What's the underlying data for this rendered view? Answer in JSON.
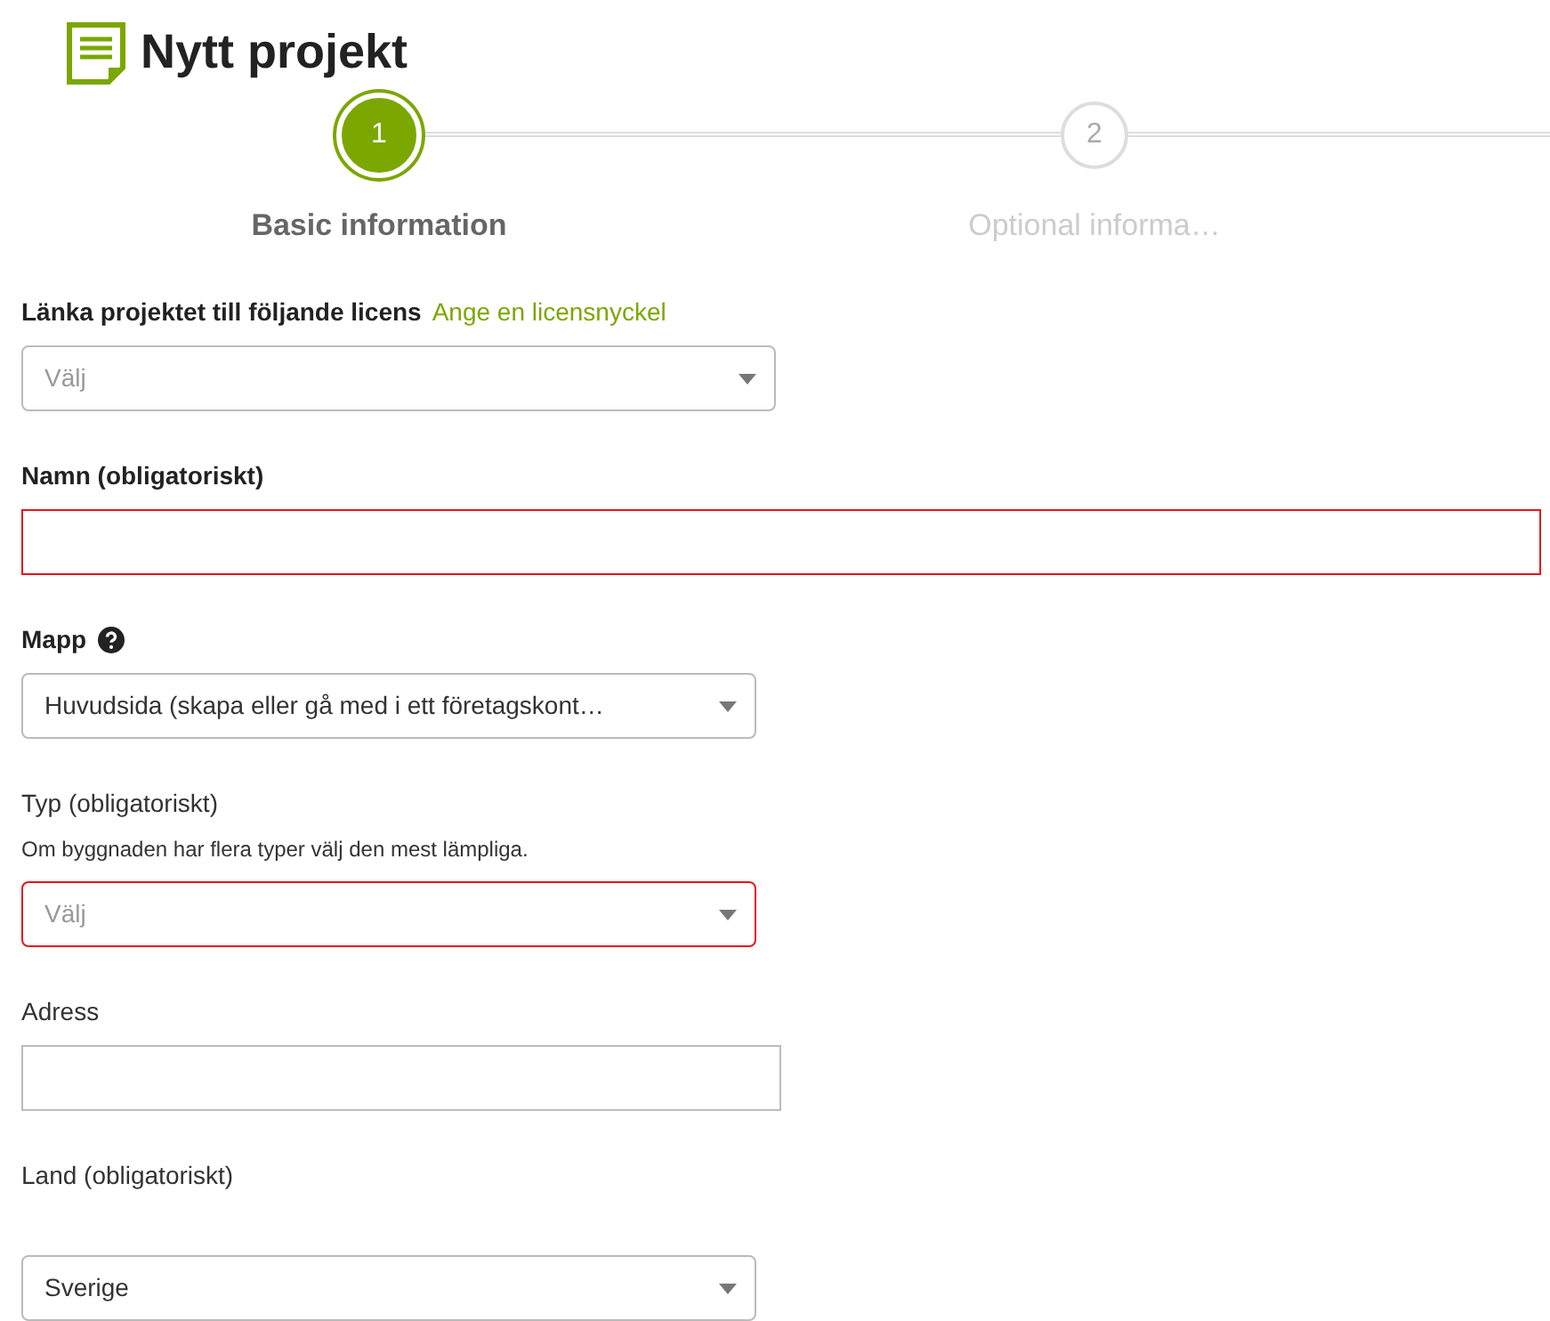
{
  "title": "Nytt projekt",
  "steps": [
    {
      "number": "1",
      "label": "Basic information",
      "selected": true
    },
    {
      "number": "2",
      "label": "Optional informa…",
      "selected": false
    }
  ],
  "fields": [
    {
      "kind": "select",
      "label": "Länka projektet till följande licens",
      "label_bold": true,
      "link": "Ange en licensnyckel",
      "placeholder": "Välj",
      "invalid": false
    },
    {
      "kind": "text",
      "label": "Namn (obligatoriskt)",
      "label_bold": true,
      "invalid": true
    },
    {
      "kind": "select",
      "label": "Mapp",
      "label_bold": true,
      "help": true,
      "value": "Huvudsida (skapa eller gå med i ett företagskont…",
      "invalid": false
    },
    {
      "kind": "select",
      "label": "Typ (obligatoriskt)",
      "label_bold": false,
      "hint": "Om byggnaden har flera typer välj den mest lämpliga.",
      "placeholder": "Välj",
      "invalid": true
    },
    {
      "kind": "text",
      "label": "Adress",
      "label_bold": false,
      "invalid": false
    },
    {
      "kind": "select",
      "label": "Land (obligatoriskt)",
      "label_bold": false,
      "value": "Sverige",
      "invalid": false
    }
  ]
}
